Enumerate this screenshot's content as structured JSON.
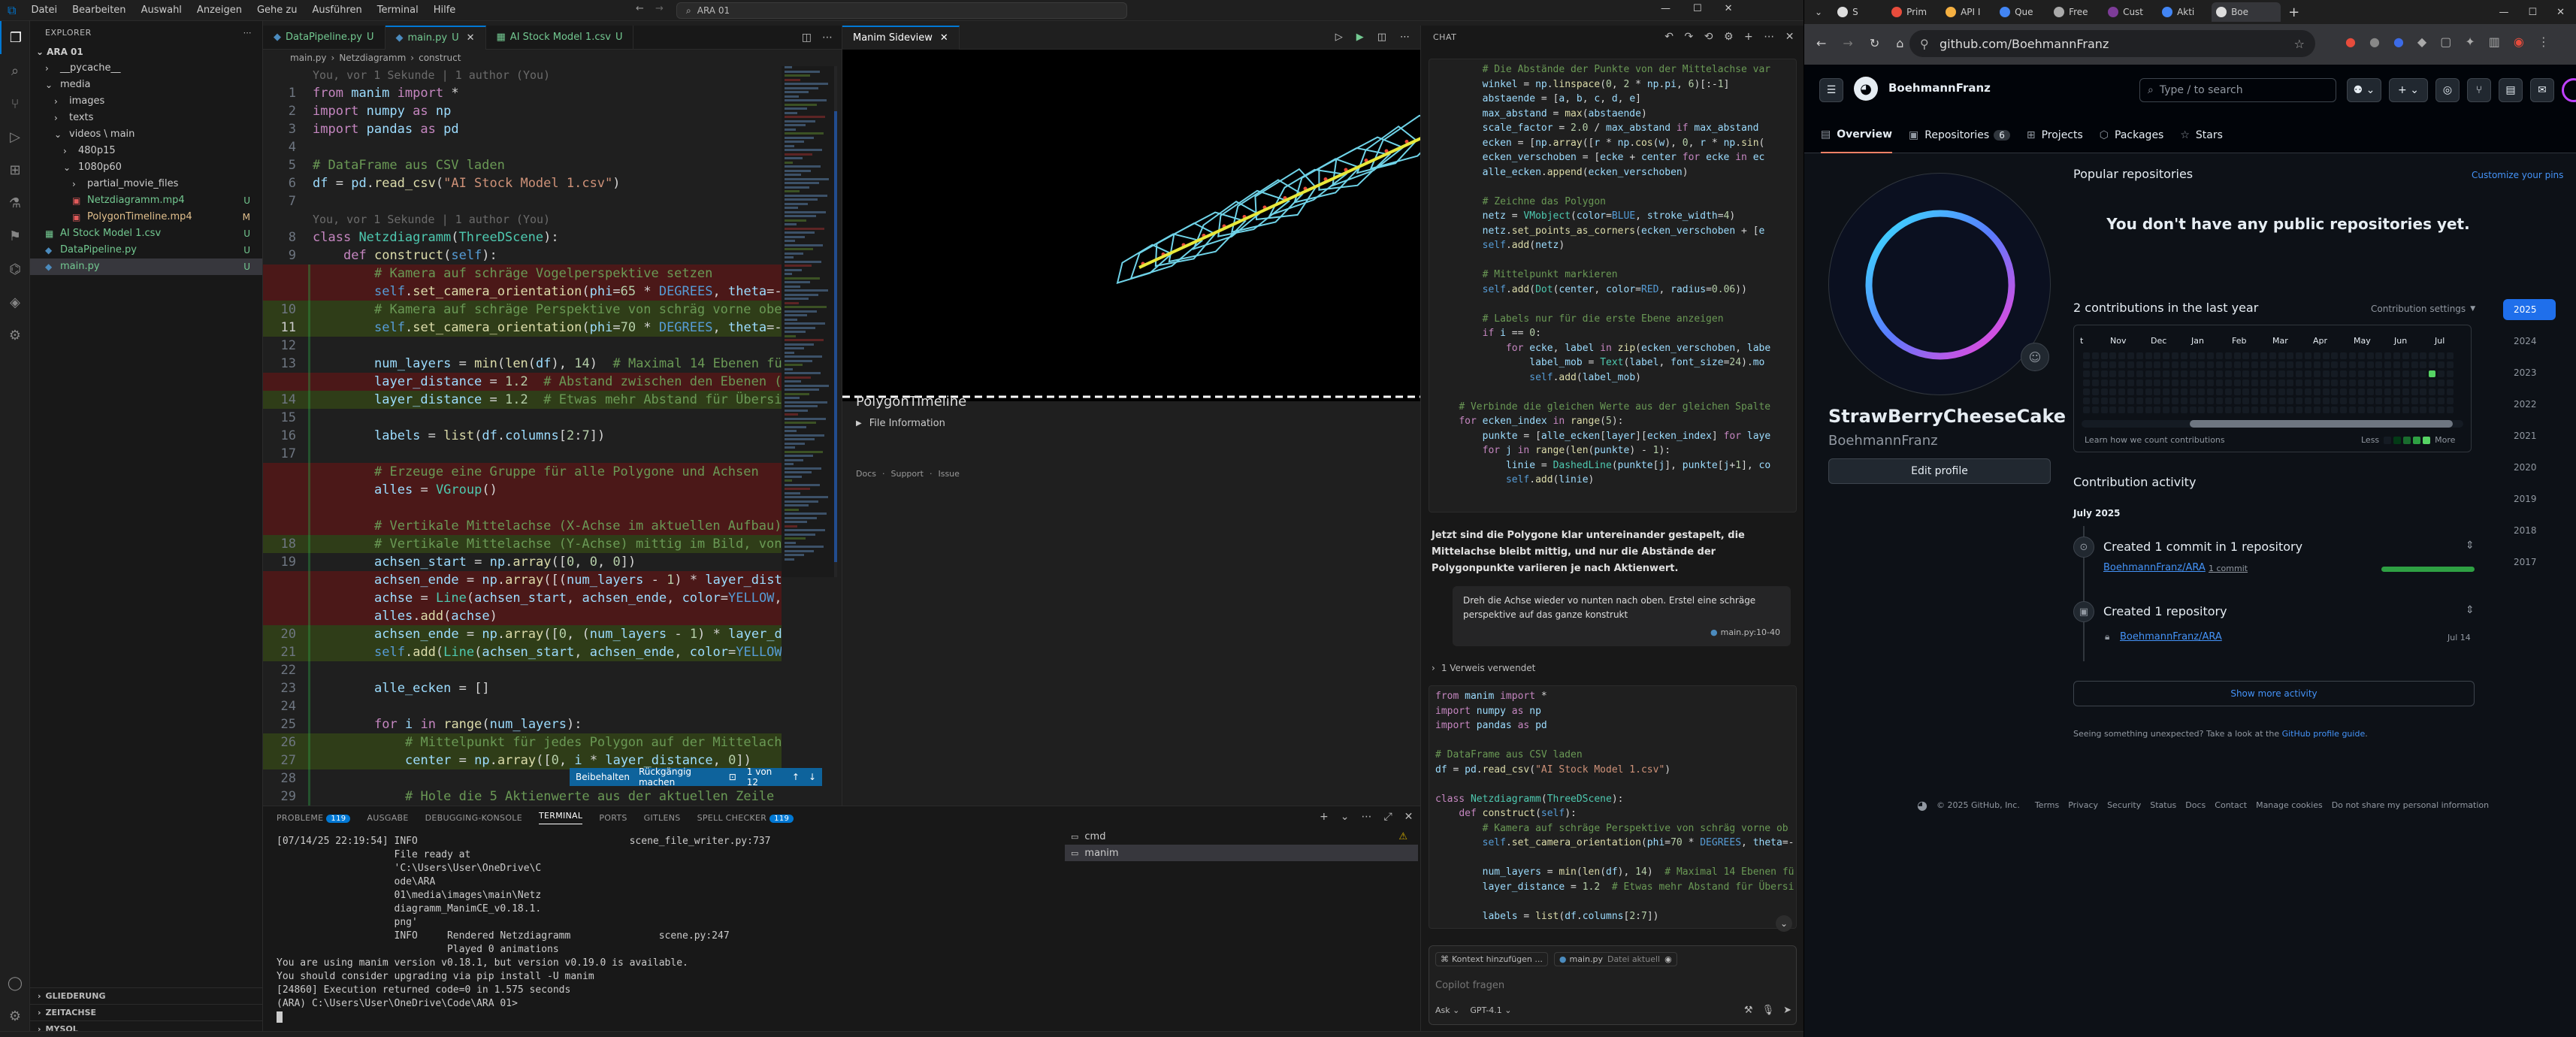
{
  "vscode": {
    "menu": [
      "Datei",
      "Bearbeiten",
      "Auswahl",
      "Anzeigen",
      "Gehe zu",
      "Ausführen",
      "Terminal",
      "Hilfe"
    ],
    "search": "ARA 01",
    "explorer": {
      "header": "EXPLORER",
      "root": "ARA 01",
      "items": [
        {
          "label": "__pycache__",
          "indent": 1,
          "type": "folder",
          "status": ""
        },
        {
          "label": "media",
          "indent": 1,
          "type": "folder-open",
          "status": ""
        },
        {
          "label": "images",
          "indent": 2,
          "type": "folder",
          "status": ""
        },
        {
          "label": "texts",
          "indent": 2,
          "type": "folder",
          "status": ""
        },
        {
          "label": "videos \\ main",
          "indent": 2,
          "type": "folder-open",
          "status": ""
        },
        {
          "label": "480p15",
          "indent": 3,
          "type": "folder",
          "status": ""
        },
        {
          "label": "1080p60",
          "indent": 3,
          "type": "folder-open",
          "status": ""
        },
        {
          "label": "partial_movie_files",
          "indent": 4,
          "type": "folder",
          "status": ""
        },
        {
          "label": "Netzdiagramm.mp4",
          "indent": 4,
          "type": "file",
          "status": "U"
        },
        {
          "label": "PolygonTimeline.mp4",
          "indent": 4,
          "type": "file",
          "status": "M"
        },
        {
          "label": "AI Stock Model 1.csv",
          "indent": 1,
          "type": "file",
          "status": "U"
        },
        {
          "label": "DataPipeline.py",
          "indent": 1,
          "type": "file",
          "status": "U"
        },
        {
          "label": "main.py",
          "indent": 1,
          "type": "file",
          "status": "U"
        }
      ],
      "footers": [
        "GLIEDERUNG",
        "ZEITACHSE",
        "MYSQL"
      ]
    },
    "tabs": [
      {
        "label": "DataPipeline.py",
        "status": "U",
        "active": false
      },
      {
        "label": "main.py",
        "status": "U",
        "active": true
      },
      {
        "label": "AI Stock Model 1.csv",
        "status": "U",
        "active": false
      }
    ],
    "breadcrumb": [
      "main.py",
      "Netzdiagramm",
      "construct"
    ],
    "code_lines": [
      {
        "n": "",
        "t": "blame",
        "s": "You, vor 1 Sekunde | 1 author (You)"
      },
      {
        "n": "1",
        "t": "",
        "s": "from manim import *"
      },
      {
        "n": "2",
        "t": "",
        "s": "import numpy as np"
      },
      {
        "n": "3",
        "t": "",
        "s": "import pandas as pd"
      },
      {
        "n": "4",
        "t": "",
        "s": ""
      },
      {
        "n": "5",
        "t": "",
        "s": "# DataFrame aus CSV laden"
      },
      {
        "n": "6",
        "t": "",
        "s": "df = pd.read_csv(\"AI Stock Model 1.csv\")"
      },
      {
        "n": "7",
        "t": "",
        "s": ""
      },
      {
        "n": "",
        "t": "blame",
        "s": "You, vor 1 Sekunde | 1 author (You)"
      },
      {
        "n": "8",
        "t": "",
        "s": "class Netzdiagramm(ThreeDScene):"
      },
      {
        "n": "9",
        "t": "",
        "s": "    def construct(self):"
      },
      {
        "n": "",
        "t": "del",
        "s": "        # Kamera auf schräge Vogelperspektive setzen"
      },
      {
        "n": "",
        "t": "del",
        "s": "        self.set_camera_orientation(phi=65 * DEGREES, theta=-"
      },
      {
        "n": "10",
        "t": "add",
        "s": "        # Kamera auf schräge Perspektive von schräg vorne obe"
      },
      {
        "n": "11",
        "t": "add cur",
        "s": "        self.set_camera_orientation(phi=70 * DEGREES, theta=-"
      },
      {
        "n": "12",
        "t": "",
        "s": ""
      },
      {
        "n": "13",
        "t": "",
        "s": "        num_layers = min(len(df), 14)  # Maximal 14 Ebenen für"
      },
      {
        "n": "",
        "t": "del",
        "s": "        layer_distance = 1.2  # Abstand zwischen den Ebenen ("
      },
      {
        "n": "14",
        "t": "add",
        "s": "        layer_distance = 1.2  # Etwas mehr Abstand für Übersi"
      },
      {
        "n": "15",
        "t": "",
        "s": ""
      },
      {
        "n": "16",
        "t": "",
        "s": "        labels = list(df.columns[2:7])"
      },
      {
        "n": "17",
        "t": "",
        "s": ""
      },
      {
        "n": "",
        "t": "del",
        "s": "        # Erzeuge eine Gruppe für alle Polygone und Achsen"
      },
      {
        "n": "",
        "t": "del",
        "s": "        alles = VGroup()"
      },
      {
        "n": "",
        "t": "del",
        "s": ""
      },
      {
        "n": "",
        "t": "del",
        "s": "        # Vertikale Mittelachse (X-Achse im aktuellen Aufbau)"
      },
      {
        "n": "18",
        "t": "add",
        "s": "        # Vertikale Mittelachse (Y-Achse) mittig im Bild, von"
      },
      {
        "n": "19",
        "t": "",
        "s": "        achsen_start = np.array([0, 0, 0])"
      },
      {
        "n": "",
        "t": "del",
        "s": "        achsen_ende = np.array([(num_layers - 1) * layer_dist"
      },
      {
        "n": "",
        "t": "del",
        "s": "        achse = Line(achsen_start, achsen_ende, color=YELLOW,"
      },
      {
        "n": "",
        "t": "del",
        "s": "        alles.add(achse)"
      },
      {
        "n": "20",
        "t": "add",
        "s": "        achsen_ende = np.array([0, (num_layers - 1) * layer_d"
      },
      {
        "n": "21",
        "t": "add",
        "s": "        self.add(Line(achsen_start, achsen_ende, color=YELLOW"
      },
      {
        "n": "22",
        "t": "",
        "s": ""
      },
      {
        "n": "23",
        "t": "",
        "s": "        alle_ecken = []"
      },
      {
        "n": "24",
        "t": "",
        "s": ""
      },
      {
        "n": "25",
        "t": "",
        "s": "        for i in range(num_layers):"
      },
      {
        "n": "26",
        "t": "add",
        "s": "            # Mittelpunkt für jedes Polygon auf der Mittelach"
      },
      {
        "n": "27",
        "t": "add",
        "s": "            center = np.array([0, i * layer_distance, 0])"
      },
      {
        "n": "28",
        "t": "",
        "s": ""
      },
      {
        "n": "29",
        "t": "",
        "s": "            # Hole die 5 Aktienwerte aus der aktuellen Zeile"
      }
    ],
    "inline_diff": {
      "keep": "Beibehalten",
      "undo": "Rückgängig machen",
      "count": "1 von 12"
    },
    "panel": {
      "tabs": [
        {
          "label": "PROBLEME",
          "badge": "119"
        },
        {
          "label": "AUSGABE",
          "badge": ""
        },
        {
          "label": "DEBUGGING-KONSOLE",
          "badge": ""
        },
        {
          "label": "TERMINAL",
          "badge": ""
        },
        {
          "label": "PORTS",
          "badge": ""
        },
        {
          "label": "GITLENS",
          "badge": ""
        },
        {
          "label": "SPELL CHECKER",
          "badge": "119"
        }
      ],
      "terminal_lines": [
        "[07/14/25 22:19:54] INFO                                    scene_file_writer.py:737",
        "                    File ready at",
        "                    'C:\\Users\\User\\OneDrive\\C",
        "                    ode\\ARA",
        "                    01\\media\\images\\main\\Netz",
        "                    diagramm_ManimCE_v0.18.1.",
        "                    png'",
        "",
        "                    INFO     Rendered Netzdiagramm               scene.py:247",
        "                             Played 0 animations",
        "You are using manim version v0.18.1, but version v0.19.0 is available.",
        "You should consider upgrading via pip install -U manim",
        "[24860] Execution returned code=0 in 1.575 seconds",
        "",
        "(ARA) C:\\Users\\User\\OneDrive\\Code\\ARA 01>"
      ],
      "terminal_list": [
        "cmd",
        "manim"
      ]
    }
  },
  "manim": {
    "tab": "Manim Sideview",
    "scene_title": "PolygonTimeline",
    "file_info": "File Information",
    "footer": [
      "Docs",
      "Support",
      "Issue"
    ]
  },
  "chat": {
    "header": "CHAT",
    "code_top": [
      "        # Die Abstände der Punkte von der Mittelachse var",
      "        winkel = np.linspace(0, 2 * np.pi, 6)[:-1]",
      "        abstaende = [a, b, c, d, e]",
      "        max_abstand = max(abstaende)",
      "        scale_factor = 2.0 / max_abstand if max_abstand",
      "        ecken = [np.array([r * np.cos(w), 0, r * np.sin(",
      "        ecken_verschoben = [ecke + center for ecke in ec",
      "        alle_ecken.append(ecken_verschoben)",
      "",
      "        # Zeichne das Polygon",
      "        netz = VMobject(color=BLUE, stroke_width=4)",
      "        netz.set_points_as_corners(ecken_verschoben + [e",
      "        self.add(netz)",
      "",
      "        # Mittelpunkt markieren",
      "        self.add(Dot(center, color=RED, radius=0.06))",
      "",
      "        # Labels nur für die erste Ebene anzeigen",
      "        if i == 0:",
      "            for ecke, label in zip(ecken_verschoben, labe",
      "                label_mob = Text(label, font_size=24).mo",
      "                self.add(label_mob)",
      "",
      "    # Verbinde die gleichen Werte aus der gleichen Spalte",
      "    for ecken_index in range(5):",
      "        punkte = [alle_ecken[layer][ecken_index] for laye",
      "        for j in range(len(punkte) - 1):",
      "            linie = DashedLine(punkte[j], punkte[j+1], co",
      "            self.add(linie)"
    ],
    "assistant_msg": "Jetzt sind die Polygone klar untereinander gestapelt, die Mittelachse bleibt mittig, und nur die Abstände der Polygonpunkte variieren je nach Aktienwert.",
    "user_msg": "Dreh die Achse wieder vo nunten nach oben. Erstel eine schräge perspektive auf das ganze konstrukt",
    "user_ref": "main.py:10-40",
    "refs_used": "1 Verweis verwendet",
    "code_bottom": [
      "from manim import *",
      "import numpy as np",
      "import pandas as pd",
      "",
      "# DataFrame aus CSV laden",
      "df = pd.read_csv(\"AI Stock Model 1.csv\")",
      "",
      "class Netzdiagramm(ThreeDScene):",
      "    def construct(self):",
      "        # Kamera auf schräge Perspektive von schräg vorne ob",
      "        self.set_camera_orientation(phi=70 * DEGREES, theta=-",
      "",
      "        num_layers = min(len(df), 14)  # Maximal 14 Ebenen fü",
      "        layer_distance = 1.2  # Etwas mehr Abstand für Übersi",
      "",
      "        labels = list(df.columns[2:7])"
    ],
    "context_btn": "Kontext hinzufügen ...",
    "context_file": "main.py",
    "context_file_note": "Datei aktuell",
    "placeholder": "Copilot fragen",
    "mode": "Ask",
    "model": "GPT-4.1"
  },
  "browser": {
    "tabs": [
      "S",
      "Prim",
      "API I",
      "Que",
      "Free",
      "Cust",
      "Akti",
      "Boe"
    ],
    "url": "github.com/BoehmannFranz",
    "github": {
      "username_header": "BoehmannFranz",
      "search_placeholder": "Type / to search",
      "nav": [
        {
          "label": "Overview",
          "count": ""
        },
        {
          "label": "Repositories",
          "count": "6"
        },
        {
          "label": "Projects",
          "count": ""
        },
        {
          "label": "Packages",
          "count": ""
        },
        {
          "label": "Stars",
          "count": ""
        }
      ],
      "display_name": "StrawBerryCheeseCake",
      "login": "BoehmannFranz",
      "edit_profile": "Edit profile",
      "popular_title": "Popular repositories",
      "customize": "Customize your pins",
      "no_repos": "You don't have any public repositories yet.",
      "contrib_title": "2 contributions in the last year",
      "contrib_settings": "Contribution settings",
      "months": [
        "t",
        "Nov",
        "Dec",
        "Jan",
        "Feb",
        "Mar",
        "Apr",
        "May",
        "Jun",
        "Jul"
      ],
      "learn_contrib": "Learn how we count contributions",
      "less": "Less",
      "more": "More",
      "years": [
        "2025",
        "2024",
        "2023",
        "2022",
        "2021",
        "2020",
        "2019",
        "2018",
        "2017"
      ],
      "activity_title": "Contribution activity",
      "activity_month": "July 2025",
      "act1_title": "Created 1 commit in 1 repository",
      "act1_repo": "BoehmannFranz/ARA",
      "act1_commits": "1 commit",
      "act2_title": "Created 1 repository",
      "act2_repo": "BoehmannFranz/ARA",
      "act2_date": "Jul 14",
      "show_more": "Show more activity",
      "unexpected": "Seeing something unexpected? Take a look at the",
      "guide_link": "GitHub profile guide",
      "footer": [
        "© 2025 GitHub, Inc.",
        "Terms",
        "Privacy",
        "Security",
        "Status",
        "Docs",
        "Contact",
        "Manage cookies",
        "Do not share my personal information"
      ]
    }
  }
}
